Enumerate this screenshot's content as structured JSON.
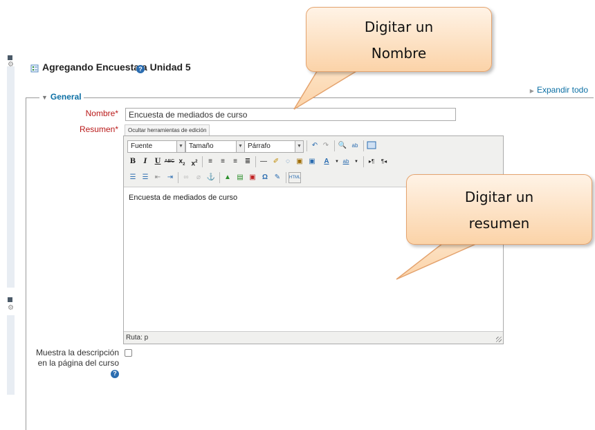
{
  "page": {
    "title": "Agregando Encuesta a Unidad 5",
    "expand_all": "Expandir todo"
  },
  "section": {
    "legend": "General"
  },
  "form": {
    "name_label": "Nombre",
    "name_value": "Encuesta de mediados de curso",
    "summary_label": "Resumen",
    "required_mark": "*",
    "toggle_tools": "Ocultar herramientas de edición",
    "show_description_label": "Muestra la descripción en la página del curso",
    "show_description_checked": false
  },
  "editor": {
    "font_select": "Fuente",
    "size_select": "Tamaño",
    "format_select": "Párrafo",
    "content": "Encuesta de mediados de curso",
    "path": "Ruta: p",
    "row2_icons": [
      "bold-icon",
      "italic-icon",
      "underline-icon",
      "strikethrough-icon",
      "subscript-icon",
      "superscript-icon",
      "align-left-icon",
      "align-center-icon",
      "align-right-icon",
      "align-justify-icon",
      "hr-icon",
      "cleanup-icon",
      "erase-icon",
      "paste-text-icon",
      "paste-word-icon",
      "font-color-icon",
      "highlight-icon",
      "ltr-icon",
      "rtl-icon"
    ],
    "row3_icons": [
      "bullet-list-icon",
      "numbered-list-icon",
      "outdent-icon",
      "indent-icon",
      "link-icon",
      "unlink-icon",
      "anchor-icon",
      "image-icon",
      "media-icon",
      "emoticon-icon",
      "special-char-icon",
      "spellcheck-icon",
      "html-icon"
    ]
  },
  "callouts": {
    "top": [
      "Digitar un",
      "Nombre"
    ],
    "right": [
      "Digitar un",
      "resumen"
    ]
  },
  "colors": {
    "link": "#0b6fa4",
    "required": "#b91919",
    "callout_fill": "#fbd3a8",
    "callout_border": "#e4a36e"
  }
}
